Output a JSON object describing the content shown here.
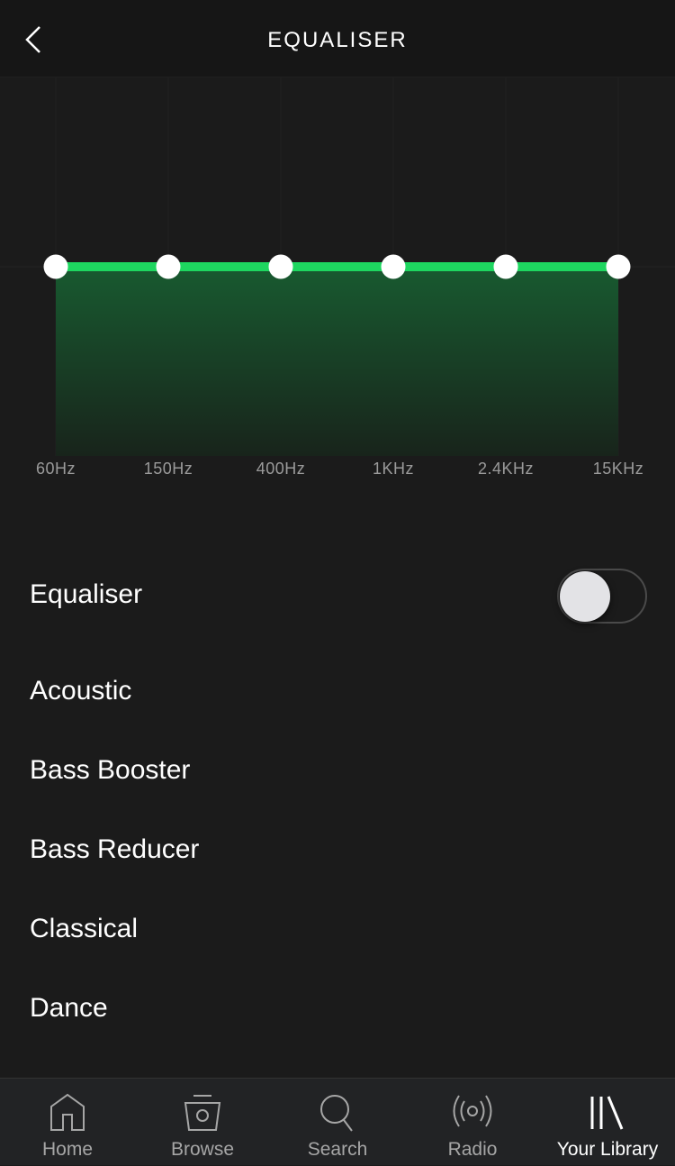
{
  "header": {
    "title": "EQUALISER",
    "back_icon": "chevron-left-icon"
  },
  "equaliser_graph": {
    "accent_color": "#1ed760",
    "bands": [
      {
        "label": "60Hz",
        "level": 0.5
      },
      {
        "label": "150Hz",
        "level": 0.5
      },
      {
        "label": "400Hz",
        "level": 0.5
      },
      {
        "label": "1KHz",
        "level": 0.5
      },
      {
        "label": "2.4KHz",
        "level": 0.5
      },
      {
        "label": "15KHz",
        "level": 0.5
      }
    ]
  },
  "settings": {
    "equaliser_label": "Equaliser",
    "equaliser_enabled": false
  },
  "presets": [
    "Acoustic",
    "Bass Booster",
    "Bass Reducer",
    "Classical",
    "Dance"
  ],
  "nav": [
    {
      "label": "Home",
      "icon": "home-icon",
      "active": false
    },
    {
      "label": "Browse",
      "icon": "browse-icon",
      "active": false
    },
    {
      "label": "Search",
      "icon": "search-icon",
      "active": false
    },
    {
      "label": "Radio",
      "icon": "radio-icon",
      "active": false
    },
    {
      "label": "Your Library",
      "icon": "library-icon",
      "active": true
    }
  ]
}
